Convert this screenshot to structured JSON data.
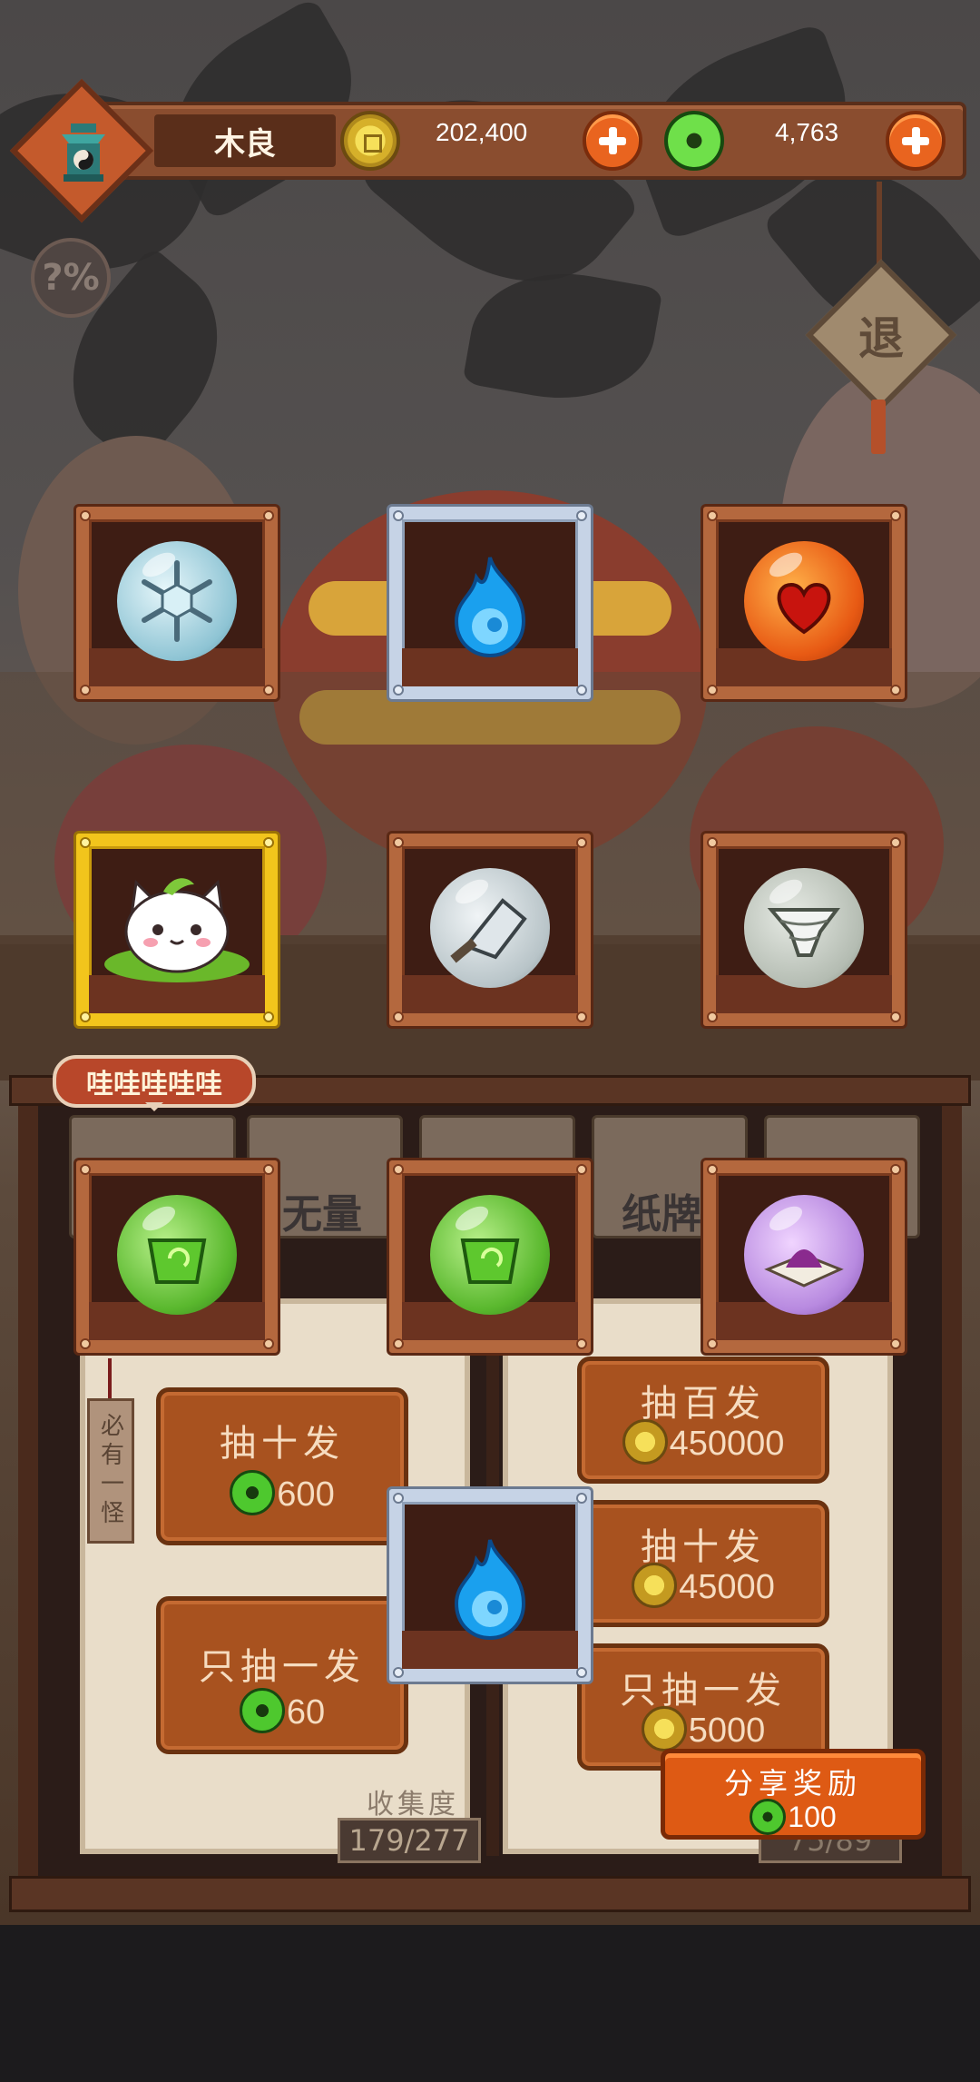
{
  "player": {
    "name": "木良",
    "avatar_icon": "pagoda-yinyang-icon"
  },
  "currency": {
    "gold": {
      "amount": "202,400",
      "icon": "gold-coin-icon"
    },
    "jade": {
      "amount": "4,763",
      "icon": "jade-coin-icon"
    }
  },
  "odds_button": {
    "label": "?%"
  },
  "exit_button": {
    "label": "退"
  },
  "speech_bubble": {
    "text": "哇哇哇哇哇"
  },
  "reward_cards": [
    {
      "rarity": "normal",
      "item": "snowflake-orb"
    },
    {
      "rarity": "rare",
      "item": "blue-flame"
    },
    {
      "rarity": "normal",
      "item": "fire-heart-orb"
    },
    {
      "rarity": "legendary",
      "item": "leaf-cat-spirit"
    },
    {
      "rarity": "normal",
      "item": "cleaver-orb"
    },
    {
      "rarity": "normal",
      "item": "whirlwind-orb"
    },
    {
      "rarity": "normal",
      "item": "green-bell-orb"
    },
    {
      "rarity": "normal",
      "item": "green-bell-orb"
    },
    {
      "rarity": "normal",
      "item": "purple-scroll-orb"
    },
    {
      "rarity": "rare",
      "item": "blue-flame"
    }
  ],
  "tabs": [
    {
      "label": "无量"
    },
    {
      "label": "纸牌"
    }
  ],
  "side_tag": {
    "text": "必有一怪"
  },
  "jade_draws": [
    {
      "title": "抽十发",
      "cost": "600"
    },
    {
      "title": "只抽一发",
      "cost": "60"
    }
  ],
  "gold_draws": [
    {
      "title": "抽百发",
      "cost": "450000"
    },
    {
      "title": "抽十发",
      "cost": "45000"
    },
    {
      "title": "只抽一发",
      "cost": "5000"
    }
  ],
  "collection": {
    "label": "收集度",
    "value": "179/277",
    "value2": "75/89"
  },
  "share": {
    "title": "分享奖励",
    "reward": "100"
  },
  "colors": {
    "gold_frame": "#f2c51c",
    "silver_frame": "#c6d3e6",
    "wood_frame": "#b4683e",
    "button": "#a8521f",
    "share_button": "#de5a14"
  }
}
